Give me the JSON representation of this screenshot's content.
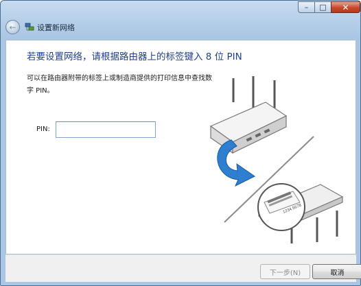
{
  "window": {
    "title": "设置新网络",
    "controls": {
      "minimize": "–",
      "maximize": "□",
      "close": "✕"
    }
  },
  "nav": {
    "back_icon": "back-arrow-icon",
    "back_glyph": "←"
  },
  "main": {
    "heading": "若要设置网络，请根据路由器上的标签键入 8 位 PIN",
    "description": "可以在路由器附带的标签上或制造商提供的打印信息中查找数字 PIN。",
    "pin": {
      "label": "PIN:",
      "value": "",
      "placeholder": ""
    }
  },
  "illustration": {
    "icon": "router-pin-label-illustration",
    "arrow_color": "#2f7fd0",
    "label_text": "1234 5678"
  },
  "footer": {
    "next_label": "下一步(N)",
    "cancel_label": "取消"
  }
}
